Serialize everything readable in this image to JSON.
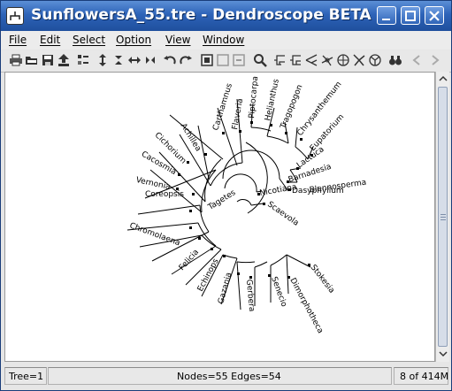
{
  "window": {
    "title": "SunflowersA_55.tre - Dendroscope BETA"
  },
  "menubar": {
    "items": [
      "File",
      "Edit",
      "Select",
      "Option",
      "View",
      "Window"
    ]
  },
  "toolbar": {
    "icons": [
      "print-icon",
      "open-icon",
      "save-icon",
      "export-icon",
      "format-icon",
      "expand-vertical-icon",
      "contract-vertical-icon",
      "expand-horizontal-icon",
      "contract-horizontal-icon",
      "rotate-left-icon",
      "rotate-right-icon",
      "zoom-fit-icon",
      "zoom-box-icon",
      "zoom-out-icon",
      "find-icon",
      "rectangular-phylogram-icon",
      "rectangular-cladogram-icon",
      "slanted-cladogram-icon",
      "circular-phylogram-icon",
      "circular-cladogram-icon",
      "radial-phylogram-icon",
      "radial-cladogram-icon",
      "binoculars-icon",
      "previous-tree-icon",
      "next-tree-icon"
    ]
  },
  "tree": {
    "leaves": [
      "Carthamnus",
      "Flaveria",
      "Piptocarpa",
      "Helianthus",
      "Tragopogon",
      "Chrysanthemum",
      "Eupatorium",
      "Achillea",
      "Cichorium",
      "Cacosmia",
      "Vernonia",
      "Lactuca",
      "Barnadesia",
      "Dasyphyllum",
      "Coreopsis",
      "Nicotiana",
      "Scaevola",
      "Blennosperma",
      "Chromolaena",
      "Tagetes",
      "Felicia",
      "Echinops",
      "Gazania",
      "Gerbera",
      "Senecio",
      "Stokesia",
      "Dimorphotheca"
    ]
  },
  "status": {
    "tree": "Tree=1",
    "nodes_edges": "Nodes=55 Edges=54",
    "memory": "8 of 414M"
  }
}
